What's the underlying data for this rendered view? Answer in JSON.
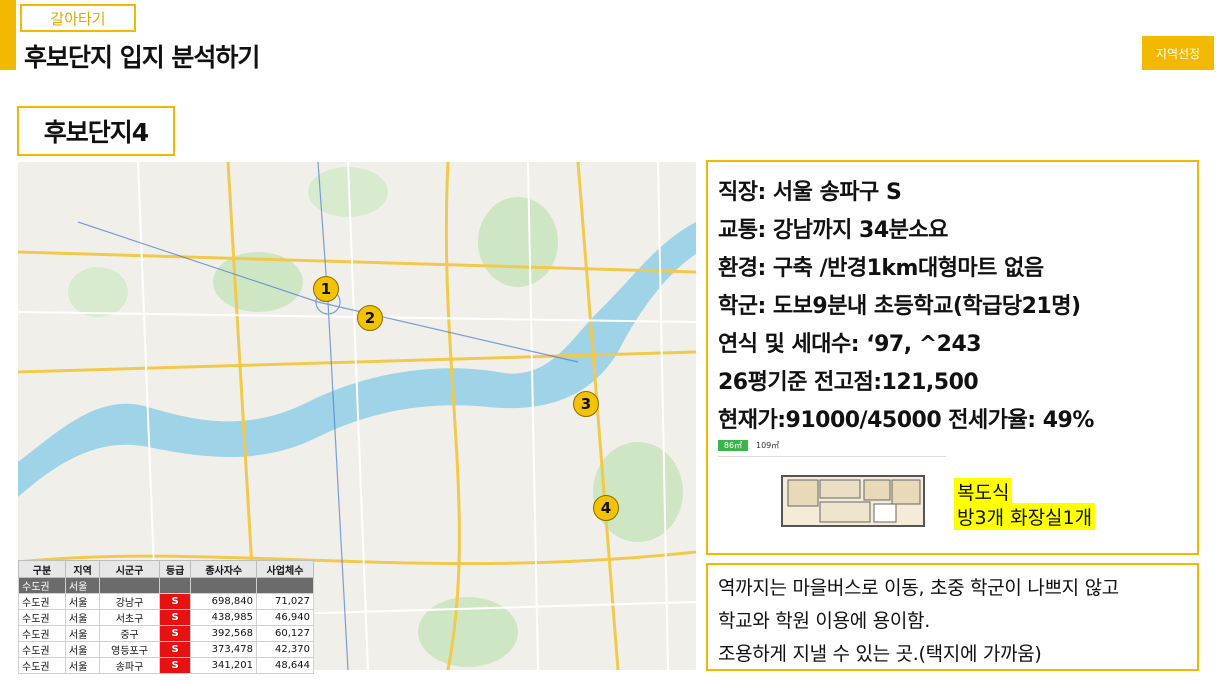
{
  "header": {
    "tag": "갈아타기",
    "title": "후보단지 입지 분석하기",
    "region_button": "지역선정",
    "accent_color": "#f3b900"
  },
  "complex_label": "후보단지4",
  "map": {
    "markers": [
      "1",
      "2",
      "3",
      "4"
    ]
  },
  "stats_table": {
    "headers": [
      "구분",
      "지역",
      "시군구",
      "등급",
      "종사자수",
      "사업체수"
    ],
    "group_row": [
      "수도권",
      "서울"
    ],
    "rows": [
      [
        "수도권",
        "서울",
        "강남구",
        "S",
        "698,840",
        "71,027"
      ],
      [
        "수도권",
        "서울",
        "서초구",
        "S",
        "438,985",
        "46,940"
      ],
      [
        "수도권",
        "서울",
        "중구",
        "S",
        "392,568",
        "60,127"
      ],
      [
        "수도권",
        "서울",
        "영등포구",
        "S",
        "373,478",
        "42,370"
      ],
      [
        "수도권",
        "서울",
        "송파구",
        "S",
        "341,201",
        "48,644"
      ]
    ]
  },
  "info": {
    "lines": [
      "직장: 서울 송파구 S",
      "교통: 강남까지 34분소요",
      "환경: 구축 /반경1km대형마트 없음",
      "학군: 도보9분내 초등학교(학급당21명)",
      "연식 및 세대수:  ‘97, ^243",
      "26평기준 전고점:121,500",
      "현재가:91000/45000   전세가율: 49%"
    ],
    "plan_tag": "86㎡",
    "plan_size": "109㎡",
    "highlight_1": "복도식",
    "highlight_2": "방3개 화장실1개"
  },
  "summary": {
    "lines": [
      "역까지는 마을버스로 이동,  초중 학군이 나쁘지 않고",
      "학교와 학원 이용에 용이함.",
      "조용하게 지낼 수 있는 곳.(택지에 가까움)"
    ]
  }
}
